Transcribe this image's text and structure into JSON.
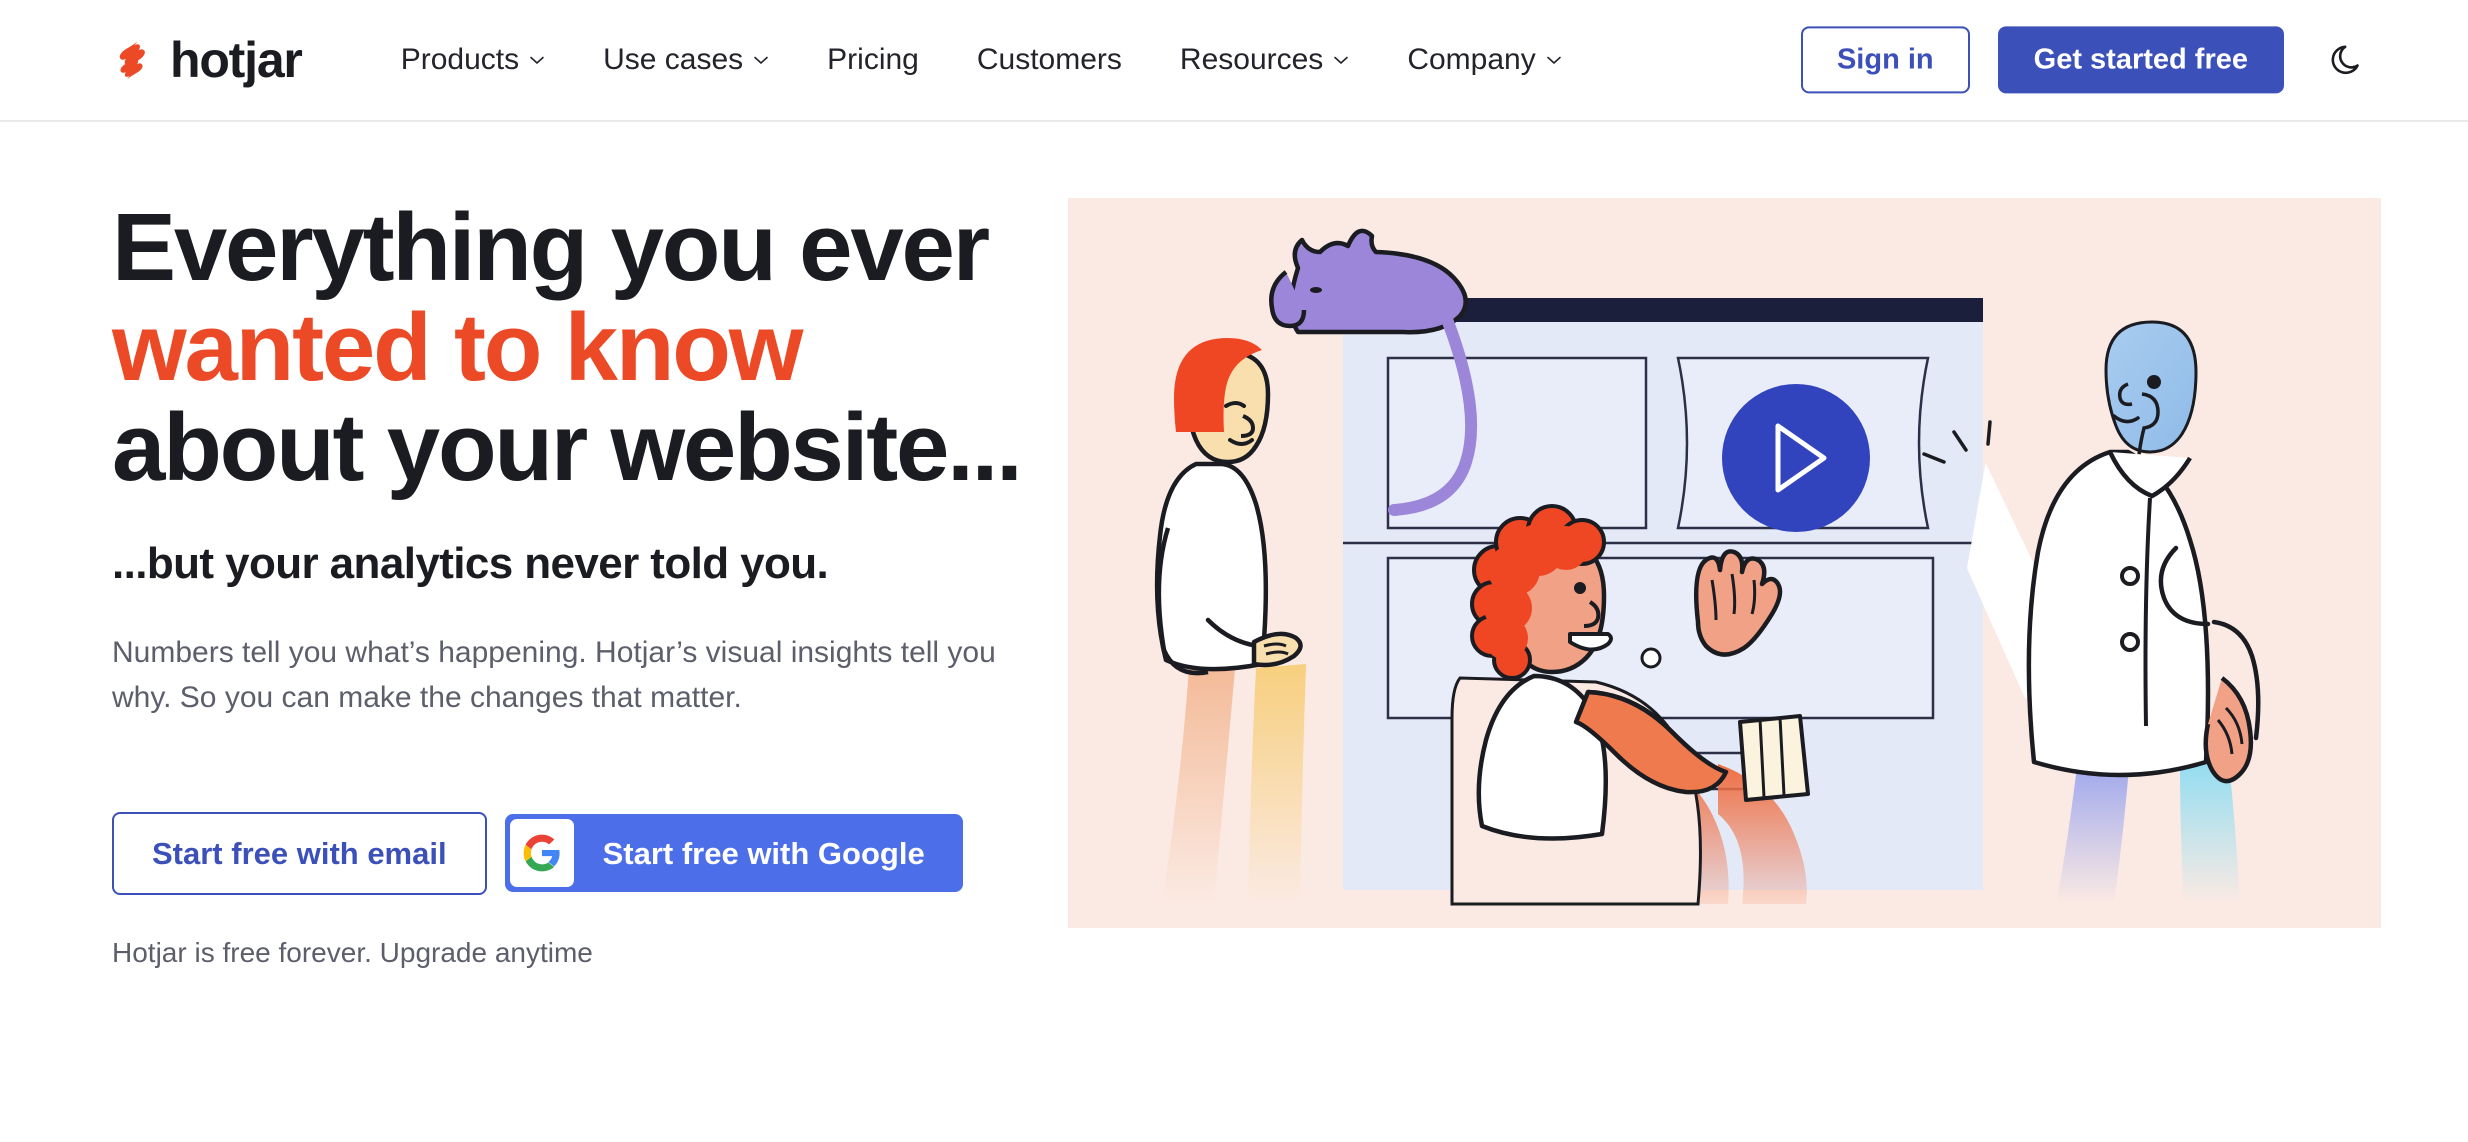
{
  "brand": {
    "name": "hotjar",
    "logo_icon": "hotjar-flame-logo",
    "accent_orange": "#ec4926",
    "accent_blue": "#3c50ba",
    "google_blue": "#4c6ee8"
  },
  "header": {
    "nav_items": [
      {
        "label": "Products",
        "has_dropdown": true,
        "icon": "chevron-down-icon"
      },
      {
        "label": "Use cases",
        "has_dropdown": true,
        "icon": "chevron-down-icon"
      },
      {
        "label": "Pricing",
        "has_dropdown": false,
        "icon": ""
      },
      {
        "label": "Customers",
        "has_dropdown": false,
        "icon": ""
      },
      {
        "label": "Resources",
        "has_dropdown": true,
        "icon": "chevron-down-icon"
      },
      {
        "label": "Company",
        "has_dropdown": true,
        "icon": "chevron-down-icon"
      }
    ],
    "sign_in_label": "Sign in",
    "get_started_label": "Get started free",
    "theme_toggle_icon": "moon-icon"
  },
  "hero": {
    "headline_part1": "Everything you ever ",
    "headline_accent": "wanted to know",
    "headline_part2": " about your website...",
    "subheadline": "...but your analytics never told you.",
    "body": "Numbers tell you what’s happening. Hotjar’s visual insights tell you why. So you can make the changes that matter.",
    "cta_email_label": "Start free with email",
    "cta_google_label": "Start free with Google",
    "cta_google_icon": "google-g-icon",
    "fineprint": "Hotjar is free forever. Upgrade anytime",
    "illustration": {
      "name": "hero-illustration",
      "background_color": "#fbeae3",
      "play_button_icon": "play-triangle-icon",
      "play_button_color": "#3244bd",
      "browser_titlebar_color": "#1b1f3b",
      "browser_body_color": "#e4e9f7",
      "cat_color": "#9b86d9",
      "cursor_icon": "cursor-arrow-icon"
    }
  }
}
